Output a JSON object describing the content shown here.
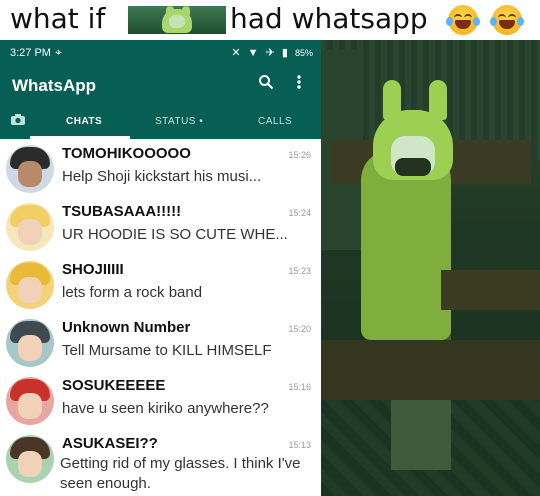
{
  "caption": {
    "before": "what if",
    "after": "had whatsapp",
    "thumbnail_icon": "hooded-girl-thumbnail-icon",
    "emoji_icon": "face-with-tears-of-joy-icon"
  },
  "status_bar": {
    "time": "3:27 PM",
    "usb_icon": "usb-icon",
    "right_icons": "✕ ▼ ✈ ▮",
    "battery": "85%"
  },
  "app": {
    "title": "WhatsApp",
    "search_icon": "search-icon",
    "more_icon": "more-vert-icon"
  },
  "tabs": {
    "camera_icon": "camera-icon",
    "chats": "CHATS",
    "status": "STATUS •",
    "calls": "CALLS",
    "active": "chats"
  },
  "chats": [
    {
      "name": "TOMOHIKOOOOO",
      "time": "15:26",
      "message": "Help Shoji kickstart his musi..."
    },
    {
      "name": "TSUBASAAA!!!!!",
      "time": "15:24",
      "message": "UR HOODIE IS SO CUTE WHE..."
    },
    {
      "name": "SHOJIIIII",
      "time": "15:23",
      "message": "lets form a rock band"
    },
    {
      "name": "Unknown Number",
      "time": "15:20",
      "message": "Tell Mursame to KILL HIMSELF"
    },
    {
      "name": "SOSUKEEEEE",
      "time": "15:16",
      "message": "have u seen kiriko anywhere??"
    },
    {
      "name": "ASUKASEI??",
      "time": "15:13",
      "message": "Getting rid of my glasses. I think I've seen enough."
    }
  ],
  "colors": {
    "whatsapp_green": "#075e54",
    "tab_inactive": "#bfe3dc",
    "timestamp": "#999999"
  }
}
